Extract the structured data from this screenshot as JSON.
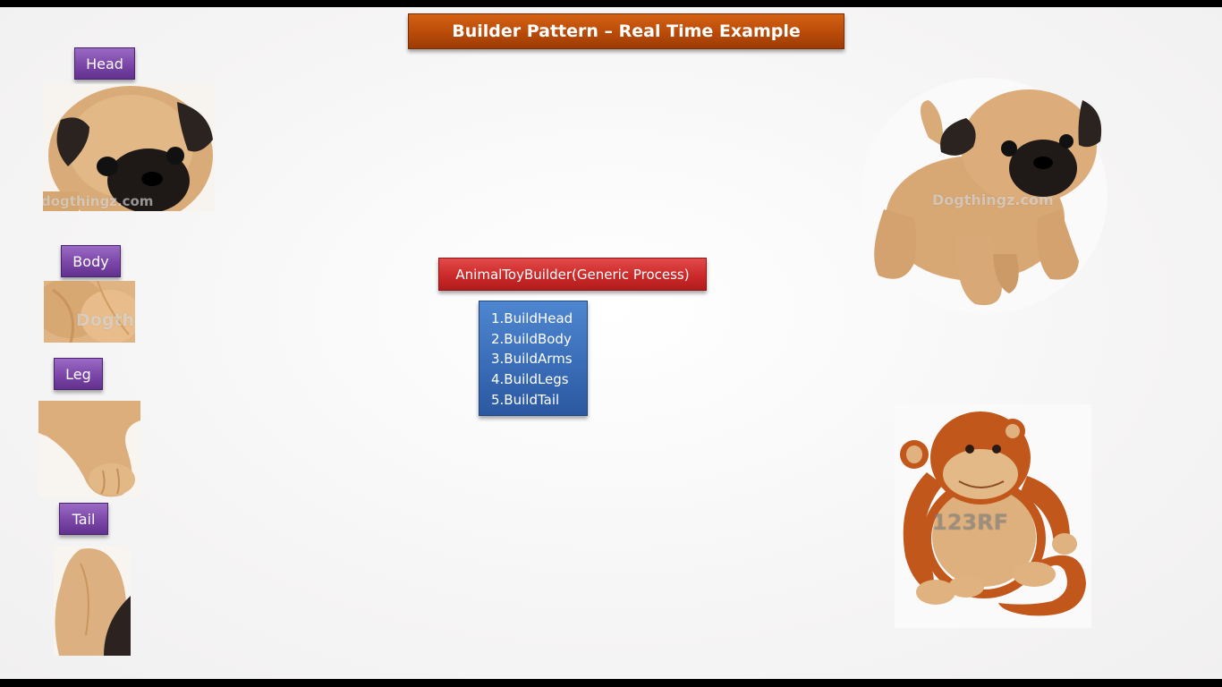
{
  "slide": {
    "title": "Builder Pattern – Real Time Example",
    "parts": [
      {
        "label": "Head"
      },
      {
        "label": "Body"
      },
      {
        "label": "Leg"
      },
      {
        "label": "Tail"
      }
    ],
    "builder_label": "AnimalToyBuilder(Generic Process)",
    "steps": [
      "1.BuildHead",
      "2.BuildBody",
      "3.BuildArms",
      "4.BuildLegs",
      "5.BuildTail"
    ],
    "watermarks": {
      "head": "dogthingz.com",
      "body": "Dogth",
      "pug": "Dogthingz.com",
      "monkey": "123RF"
    },
    "colors": {
      "title_bg": "#b94b09",
      "tag_bg": "#7b46a8",
      "builder_bg": "#cc2a2a",
      "steps_bg": "#3a6db8",
      "fur": "#d9ab78",
      "monkey": "#c2571c"
    },
    "icons": {
      "head": "pug-head-image",
      "body": "pug-body-fur-image",
      "leg": "pug-leg-image",
      "tail": "pug-tail-image",
      "pug": "pug-toy-image",
      "monkey": "monkey-toy-image"
    }
  }
}
